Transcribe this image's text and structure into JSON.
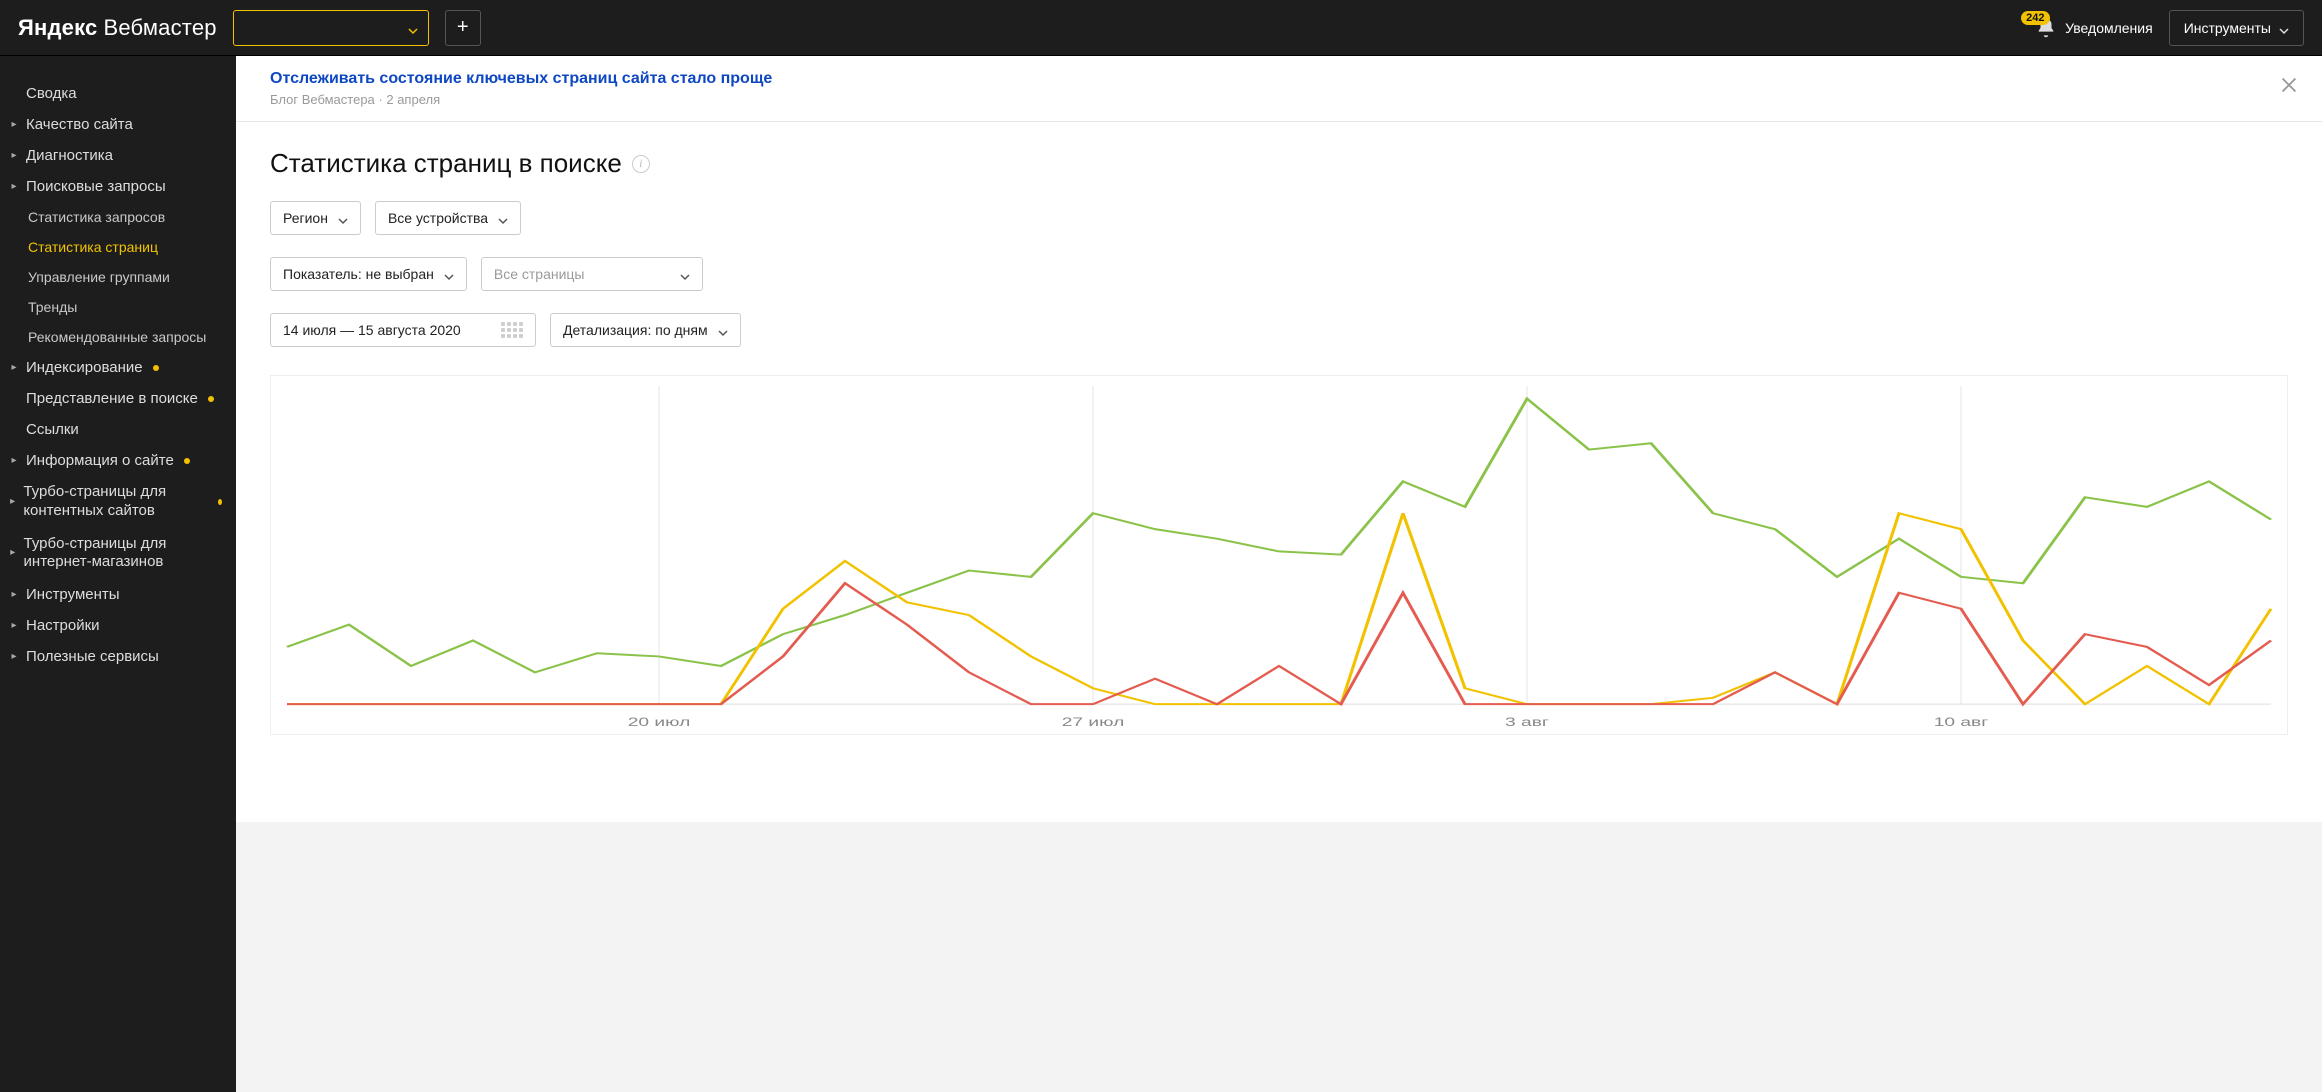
{
  "header": {
    "logo_primary": "Яндекс",
    "logo_secondary": "Вебмастер",
    "notifications_label": "Уведомления",
    "notifications_count": "242",
    "tools_label": "Инструменты"
  },
  "sidebar": {
    "items": [
      {
        "id": "summary",
        "label": "Сводка",
        "caret": false
      },
      {
        "id": "quality",
        "label": "Качество сайта",
        "caret": true
      },
      {
        "id": "diagnostics",
        "label": "Диагностика",
        "caret": true
      },
      {
        "id": "queries",
        "label": "Поисковые запросы",
        "caret": true,
        "expanded": true,
        "children": [
          {
            "id": "q-stats",
            "label": "Статистика запросов"
          },
          {
            "id": "p-stats",
            "label": "Статистика страниц",
            "active": true
          },
          {
            "id": "groups",
            "label": "Управление группами"
          },
          {
            "id": "trends",
            "label": "Тренды"
          },
          {
            "id": "recs",
            "label": "Рекомендованные запросы"
          }
        ]
      },
      {
        "id": "indexing",
        "label": "Индексирование",
        "caret": true,
        "dot": true
      },
      {
        "id": "appearance",
        "label": "Представление в поиске",
        "caret": false,
        "dot": true
      },
      {
        "id": "links",
        "label": "Ссылки",
        "caret": false
      },
      {
        "id": "siteinfo",
        "label": "Информация о сайте",
        "caret": true,
        "dot": true
      },
      {
        "id": "turbo-content",
        "label": "Турбо-страницы для контентных сайтов",
        "caret": true,
        "dot": true,
        "multiline": true
      },
      {
        "id": "turbo-shop",
        "label": "Турбо-страницы для интернет-магазинов",
        "caret": true,
        "multiline": true
      },
      {
        "id": "tools",
        "label": "Инструменты",
        "caret": true
      },
      {
        "id": "settings",
        "label": "Настройки",
        "caret": true
      },
      {
        "id": "useful",
        "label": "Полезные сервисы",
        "caret": true
      }
    ]
  },
  "banner": {
    "title": "Отслеживать состояние ключевых страниц сайта стало проще",
    "source": "Блог Вебмастера",
    "date": "2 апреля"
  },
  "page": {
    "title": "Статистика страниц в поиске",
    "filters": {
      "region": "Регион",
      "devices": "Все устройства",
      "metric": "Показатель: не выбран",
      "pages_placeholder": "Все страницы",
      "date_range": "14 июля — 15 августа 2020",
      "detail": "Детализация: по дням"
    }
  },
  "chart_data": {
    "type": "line",
    "xlabel": "",
    "ylabel": "",
    "ylim": [
      0,
      100
    ],
    "x": [
      "14 июл",
      "15 июл",
      "16 июл",
      "17 июл",
      "18 июл",
      "19 июл",
      "20 июл",
      "21 июл",
      "22 июл",
      "23 июл",
      "24 июл",
      "25 июл",
      "26 июл",
      "27 июл",
      "28 июл",
      "29 июл",
      "30 июл",
      "31 июл",
      "1 авг",
      "2 авг",
      "3 авг",
      "4 авг",
      "5 авг",
      "6 авг",
      "7 авг",
      "8 авг",
      "9 авг",
      "10 авг",
      "11 авг",
      "12 авг",
      "13 авг",
      "14 авг",
      "15 авг"
    ],
    "tick_labels": [
      "20 июл",
      "27 июл",
      "3 авг",
      "10 авг"
    ],
    "tick_x": [
      "20 июл",
      "27 июл",
      "3 авг",
      "10 авг"
    ],
    "series": [
      {
        "name": "green",
        "color": "#8bc34a",
        "values": [
          18,
          25,
          12,
          20,
          10,
          16,
          15,
          12,
          22,
          28,
          35,
          42,
          40,
          60,
          55,
          52,
          48,
          47,
          70,
          62,
          96,
          80,
          82,
          60,
          55,
          40,
          52,
          40,
          38,
          65,
          62,
          70,
          58
        ]
      },
      {
        "name": "yellow",
        "color": "#f2c200",
        "values": [
          0,
          0,
          0,
          0,
          0,
          0,
          0,
          0,
          30,
          45,
          32,
          28,
          15,
          5,
          0,
          0,
          0,
          0,
          60,
          5,
          0,
          0,
          0,
          2,
          10,
          0,
          60,
          55,
          20,
          0,
          12,
          0,
          30
        ]
      },
      {
        "name": "red",
        "color": "#e45b4f",
        "values": [
          0,
          0,
          0,
          0,
          0,
          0,
          0,
          0,
          15,
          38,
          25,
          10,
          0,
          0,
          8,
          0,
          12,
          0,
          35,
          0,
          0,
          0,
          0,
          0,
          10,
          0,
          35,
          30,
          0,
          22,
          18,
          6,
          20
        ]
      }
    ]
  }
}
